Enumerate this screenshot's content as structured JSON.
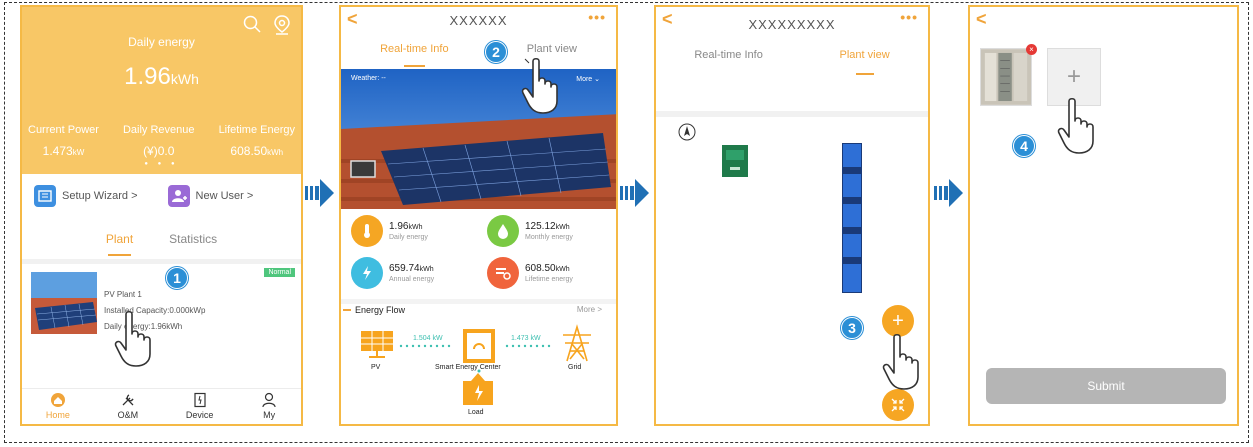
{
  "screen1": {
    "daily_label": "Daily energy",
    "daily_value": "1.96",
    "daily_unit": "kWh",
    "stats": [
      {
        "label": "Current Power",
        "value": "1.473",
        "unit": "kW"
      },
      {
        "label": "Daily Revenue",
        "value": "(¥)0.0",
        "unit": ""
      },
      {
        "label": "Lifetime Energy",
        "value": "608.50",
        "unit": "kWh"
      }
    ],
    "shortcuts": [
      {
        "label": "Setup Wizard >"
      },
      {
        "label": "New User >"
      }
    ],
    "tabs": [
      "Plant",
      "Statistics"
    ],
    "plant": {
      "status": "Normal",
      "name": "PV Plant 1",
      "capacity": "Installed Capacity:0.000kWp",
      "daily": "Daily energy:1.96kWh"
    },
    "nav": [
      "Home",
      "O&M",
      "Device",
      "My"
    ],
    "step": "1"
  },
  "screen2": {
    "title": "XXXXXX",
    "tabs": [
      "Real-time Info",
      "Plant view"
    ],
    "weather": "Weather: --",
    "more": "More",
    "kpis": [
      {
        "value": "1.96",
        "unit": "kWh",
        "label": "Daily energy",
        "color": "#f5a623"
      },
      {
        "value": "125.12",
        "unit": "kWh",
        "label": "Monthly energy",
        "color": "#7ac943"
      },
      {
        "value": "659.74",
        "unit": "kWh",
        "label": "Annual energy",
        "color": "#3fbde0"
      },
      {
        "value": "608.50",
        "unit": "kWh",
        "label": "Lifetime energy",
        "color": "#f0643c"
      }
    ],
    "flow_title": "Energy Flow",
    "flow_more": "More >",
    "flow": {
      "pv_label": "PV",
      "center_label": "Smart Energy Center",
      "grid_label": "Grid",
      "load_label": "Load",
      "pv_power": "1.504 kW",
      "grid_power": "1.473 kW"
    },
    "step": "2"
  },
  "screen3": {
    "title": "XXXXXXXXX",
    "tabs": [
      "Real-time Info",
      "Plant view"
    ],
    "step": "3"
  },
  "screen4": {
    "submit_label": "Submit",
    "step": "4"
  },
  "colors": {
    "accent": "#f0a43a",
    "header_bg": "#f8c766",
    "step_badge": "#2b8fd6",
    "arrow": "#2070b5"
  }
}
